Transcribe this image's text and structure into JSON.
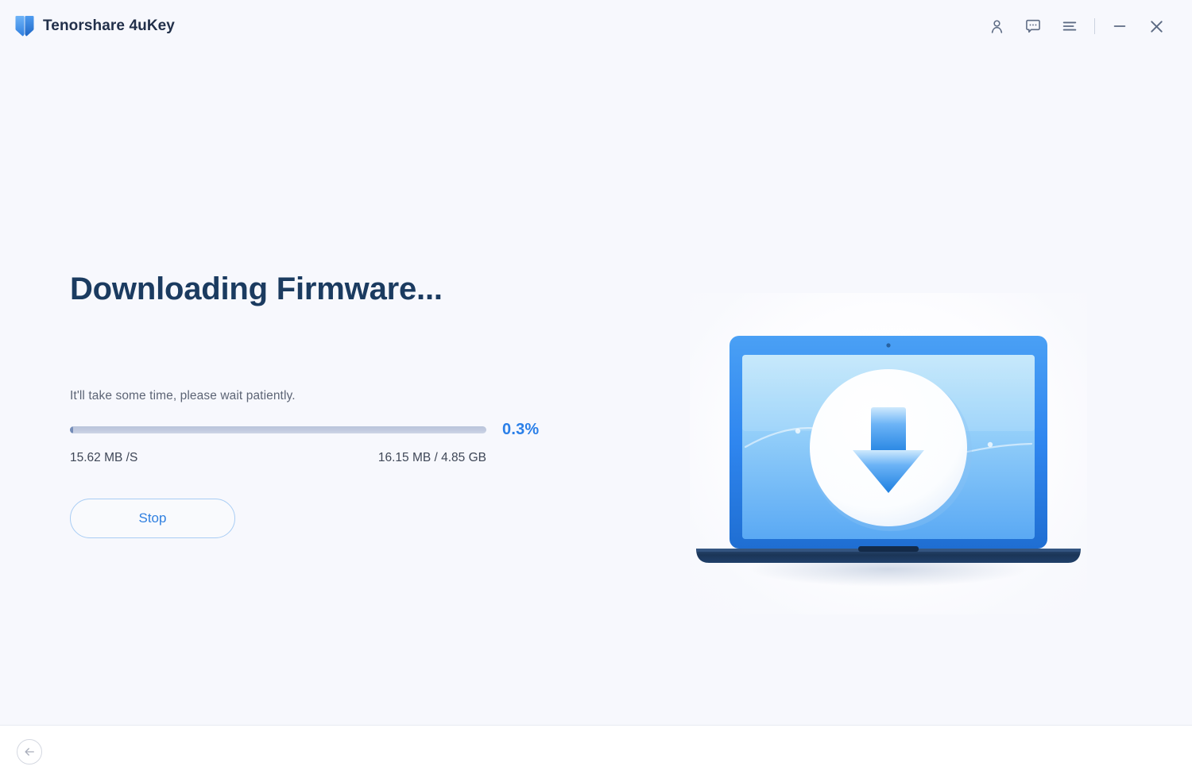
{
  "window": {
    "brand_name": "Tenorshare 4uKey",
    "logo_icon": "shield-book-logo",
    "controls": [
      {
        "name": "account-icon",
        "label": "Account"
      },
      {
        "name": "feedback-icon",
        "label": "Feedback"
      },
      {
        "name": "menu-icon",
        "label": "Menu"
      },
      {
        "name": "minimize-icon",
        "label": "Minimize"
      },
      {
        "name": "close-icon",
        "label": "Close"
      }
    ]
  },
  "main": {
    "title": "Downloading Firmware...",
    "hint": "It'll take some time, please wait patiently.",
    "progress": {
      "percent_label": "0.3%",
      "percent_value": 0.3,
      "speed": "15.62 MB /S",
      "downloaded": "16.15 MB / 4.85 GB"
    },
    "stop_label": "Stop",
    "illustration": {
      "name": "laptop-download-illustration",
      "screen_icon": "download-arrow-icon"
    }
  },
  "footer": {
    "back_icon": "arrow-left-circle-icon"
  },
  "colors": {
    "accent": "#2a7fe8",
    "title": "#1b3b60",
    "background": "#f7f8fd",
    "button_border": "#a9cdf4",
    "progress_track": "#c2cbdf"
  }
}
